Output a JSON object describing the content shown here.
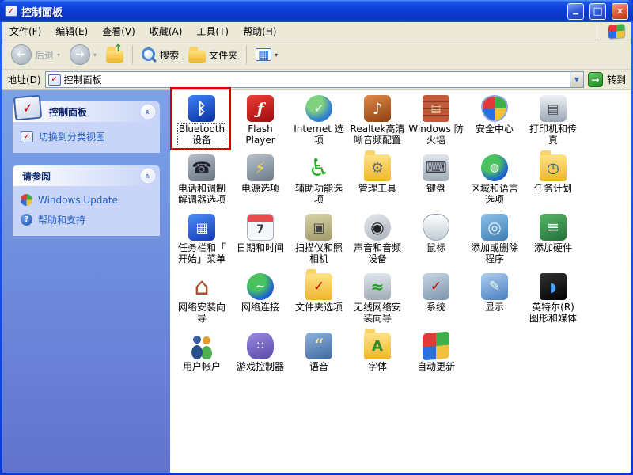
{
  "window": {
    "title": "控制面板"
  },
  "menu_bar": {
    "items": [
      "文件(F)",
      "编辑(E)",
      "查看(V)",
      "收藏(A)",
      "工具(T)",
      "帮助(H)"
    ]
  },
  "toolbar": {
    "back_label": "后退",
    "search_label": "搜索",
    "folders_label": "文件夹"
  },
  "address_bar": {
    "label": "地址(D)",
    "value": "控制面板",
    "go_label": "转到"
  },
  "sidebar": {
    "panels": [
      {
        "title": "控制面板",
        "items": [
          {
            "label": "切换到分类视图",
            "icon": "category-view"
          }
        ]
      },
      {
        "title": "请参阅",
        "items": [
          {
            "label": "Windows Update",
            "icon": "windows-update"
          },
          {
            "label": "帮助和支持",
            "icon": "help-support"
          }
        ]
      }
    ]
  },
  "grid": {
    "items": [
      {
        "label": "Bluetooth\n设备",
        "icon": "bluetooth-devices",
        "selected": true
      },
      {
        "label": "Flash\nPlayer",
        "icon": "flash-player"
      },
      {
        "label": "Internet 选\n项",
        "icon": "internet-options"
      },
      {
        "label": "Realtek高清\n晰音频配置",
        "icon": "realtek-audio"
      },
      {
        "label": "Windows 防\n火墙",
        "icon": "windows-firewall"
      },
      {
        "label": "安全中心",
        "icon": "security-center"
      },
      {
        "label": "打印机和传\n真",
        "icon": "printers-faxes"
      },
      {
        "label": "电话和调制\n解调器选项",
        "icon": "phone-modem"
      },
      {
        "label": "电源选项",
        "icon": "power-options"
      },
      {
        "label": "辅助功能选\n项",
        "icon": "accessibility-options"
      },
      {
        "label": "管理工具",
        "icon": "admin-tools"
      },
      {
        "label": "键盘",
        "icon": "keyboard"
      },
      {
        "label": "区域和语言\n选项",
        "icon": "regional-language"
      },
      {
        "label": "任务计划",
        "icon": "scheduled-tasks"
      },
      {
        "label": "任务栏和「\n开始」菜单",
        "icon": "taskbar-startmenu"
      },
      {
        "label": "日期和时间",
        "icon": "date-time"
      },
      {
        "label": "扫描仪和照\n相机",
        "icon": "scanners-cameras"
      },
      {
        "label": "声音和音频\n设备",
        "icon": "sounds-audio"
      },
      {
        "label": "鼠标",
        "icon": "mouse"
      },
      {
        "label": "添加或删除\n程序",
        "icon": "add-remove-programs"
      },
      {
        "label": "添加硬件",
        "icon": "add-hardware"
      },
      {
        "label": "网络安装向\n导",
        "icon": "network-setup-wizard"
      },
      {
        "label": "网络连接",
        "icon": "network-connections"
      },
      {
        "label": "文件夹选项",
        "icon": "folder-options"
      },
      {
        "label": "无线网络安\n装向导",
        "icon": "wireless-network-wizard"
      },
      {
        "label": "系统",
        "icon": "system"
      },
      {
        "label": "显示",
        "icon": "display"
      },
      {
        "label": "英特尔(R)\n图形和媒体",
        "icon": "intel-graphics-media"
      },
      {
        "label": "用户帐户",
        "icon": "user-accounts"
      },
      {
        "label": "游戏控制器",
        "icon": "game-controllers"
      },
      {
        "label": "语音",
        "icon": "speech"
      },
      {
        "label": "字体",
        "icon": "fonts"
      },
      {
        "label": "自动更新",
        "icon": "automatic-updates"
      }
    ]
  },
  "annotation": {
    "shape": "red-box",
    "highlights": "Bluetooth 设备",
    "color": "#d40000"
  },
  "colors": {
    "titlebar_blue": "#0a3ad0",
    "chrome_beige": "#ece9d8",
    "sidebar_top": "#7ba2e7",
    "sidebar_bottom": "#6173cd",
    "panel_body": "#c8d4f8",
    "link_blue": "#215dc6",
    "annotation_red": "#d40000"
  }
}
